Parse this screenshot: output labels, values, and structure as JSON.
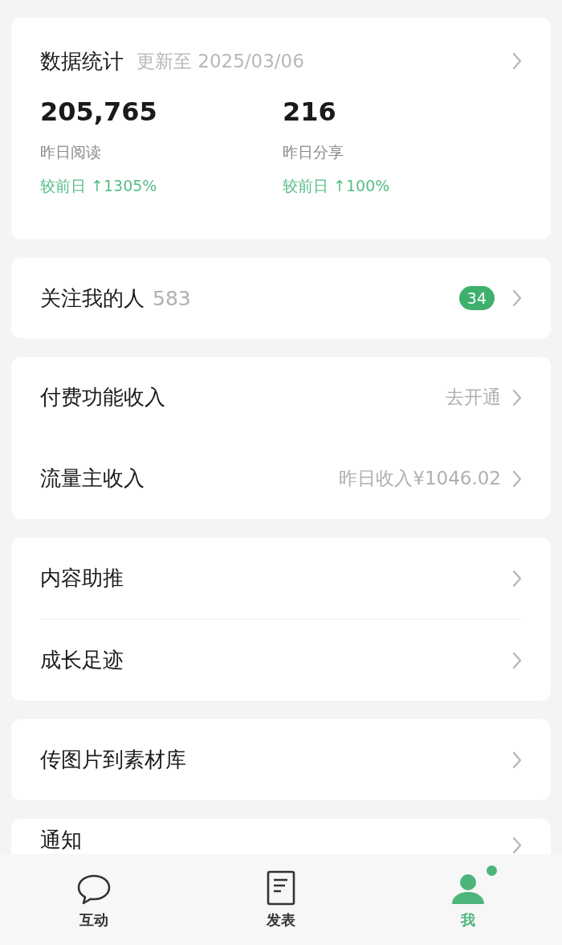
{
  "stats": {
    "title": "数据统计",
    "updated": "更新至 2025/03/06",
    "metrics": [
      {
        "value": "205,765",
        "label": "昨日阅读",
        "change": "较前日 ↑1305%"
      },
      {
        "value": "216",
        "label": "昨日分享",
        "change": "较前日 ↑100%"
      }
    ]
  },
  "followers": {
    "label": "关注我的人",
    "count": "583",
    "badge": "34"
  },
  "groups": [
    {
      "divided": false,
      "rows": [
        {
          "label": "付费功能收入",
          "detail": "去开通"
        },
        {
          "label": "流量主收入",
          "detail": "昨日收入¥1046.02"
        }
      ]
    },
    {
      "divided": true,
      "rows": [
        {
          "label": "内容助推"
        },
        {
          "label": "成长足迹"
        }
      ]
    },
    {
      "divided": false,
      "rows": [
        {
          "label": "传图片到素材库"
        }
      ]
    },
    {
      "divided": false,
      "rows": [
        {
          "label": "通知"
        }
      ]
    }
  ],
  "tabs": [
    {
      "kind": "chat",
      "label": "互动",
      "selected": false,
      "dot": false
    },
    {
      "kind": "document",
      "label": "发表",
      "selected": false,
      "dot": false
    },
    {
      "kind": "person",
      "label": "我",
      "selected": true,
      "dot": true
    }
  ]
}
